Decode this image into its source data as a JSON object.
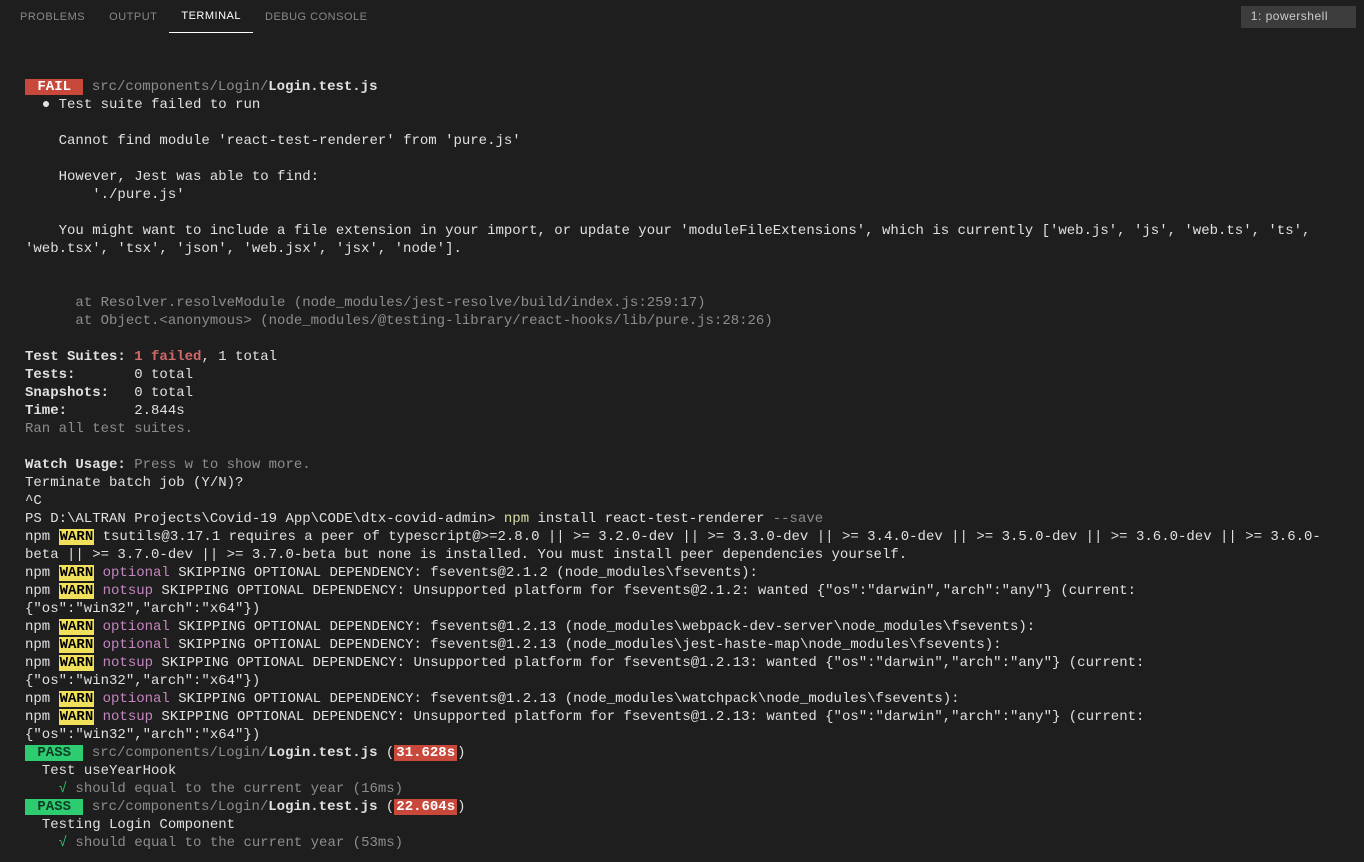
{
  "tabs": {
    "problems": "PROBLEMS",
    "output": "OUTPUT",
    "terminal": "TERMINAL",
    "debug": "DEBUG CONSOLE"
  },
  "shell": "1: powershell",
  "fail": {
    "badge": " FAIL ",
    "path_dim": " src/components/Login/",
    "path_file": "Login.test.js",
    "bullet": "  ● ",
    "suite_failed": "Test suite failed to run",
    "err_line": "    Cannot find module 'react-test-renderer' from 'pure.js'",
    "however": "    However, Jest was able to find:",
    "purejs": "        './pure.js'",
    "hint": "    You might want to include a file extension in your import, or update your 'moduleFileExtensions', which is currently ['web.js', 'js', 'web.ts', 'ts', 'web.tsx', 'tsx', 'json', 'web.jsx', 'jsx', 'node'].",
    "stack1": "      at Resolver.resolveModule (node_modules/jest-resolve/build/index.js:259:17)",
    "stack2": "      at Object.<anonymous> (node_modules/@testing-library/react-hooks/lib/pure.js:28:26)"
  },
  "summary": {
    "suites_label": "Test Suites: ",
    "suites_fail": "1 failed",
    "suites_rest": ", 1 total",
    "tests_label": "Tests:       ",
    "tests_val": "0 total",
    "snap_label": "Snapshots:   ",
    "snap_val": "0 total",
    "time_label": "Time:        ",
    "time_val": "2.844s",
    "ran": "Ran all test suites."
  },
  "watch": {
    "label": "Watch Usage: ",
    "text": "Press w to show more."
  },
  "batch": {
    "terminate": "Terminate batch job (Y/N)?",
    "ctrlc": "^C"
  },
  "prompt": {
    "path": "PS D:\\ALTRAN Projects\\Covid-19 App\\CODE\\dtx-covid-admin> ",
    "cmd_npm": "npm",
    "cmd_rest": " install react-test-renderer ",
    "cmd_save": "--save"
  },
  "npm_lines": [
    {
      "prefix": "npm ",
      "warn": "WARN",
      "mid": " tsutils@3.17.1 requires a peer of typescript@>=2.8.0 || >= 3.2.0-dev || >= 3.3.0-dev || >= 3.4.0-dev || >= 3.5.0-dev || >= 3.6.0-dev || >= 3.6.0-beta || >= 3.7.0-dev || >= 3.7.0-beta but none is installed. You must install peer dependencies yourself."
    },
    {
      "prefix": "npm ",
      "warn": "WARN",
      "kind": " optional",
      "mid": " SKIPPING OPTIONAL DEPENDENCY: fsevents@2.1.2 (node_modules\\fsevents):"
    },
    {
      "prefix": "npm ",
      "warn": "WARN",
      "kind": " notsup",
      "mid": " SKIPPING OPTIONAL DEPENDENCY: Unsupported platform for fsevents@2.1.2: wanted {\"os\":\"darwin\",\"arch\":\"any\"} (current: {\"os\":\"win32\",\"arch\":\"x64\"})"
    },
    {
      "prefix": "npm ",
      "warn": "WARN",
      "kind": " optional",
      "mid": " SKIPPING OPTIONAL DEPENDENCY: fsevents@1.2.13 (node_modules\\webpack-dev-server\\node_modules\\fsevents):"
    },
    {
      "prefix": "npm ",
      "warn": "WARN",
      "kind": " optional",
      "mid": " SKIPPING OPTIONAL DEPENDENCY: fsevents@1.2.13 (node_modules\\jest-haste-map\\node_modules\\fsevents):"
    },
    {
      "prefix": "npm ",
      "warn": "WARN",
      "kind": " notsup",
      "mid": " SKIPPING OPTIONAL DEPENDENCY: Unsupported platform for fsevents@1.2.13: wanted {\"os\":\"darwin\",\"arch\":\"any\"} (current: {\"os\":\"win32\",\"arch\":\"x64\"})"
    },
    {
      "prefix": "npm ",
      "warn": "WARN",
      "kind": " optional",
      "mid": " SKIPPING OPTIONAL DEPENDENCY: fsevents@1.2.13 (node_modules\\watchpack\\node_modules\\fsevents):"
    },
    {
      "prefix": "npm ",
      "warn": "WARN",
      "kind": " notsup",
      "mid": " SKIPPING OPTIONAL DEPENDENCY: Unsupported platform for fsevents@1.2.13: wanted {\"os\":\"darwin\",\"arch\":\"any\"} (current: {\"os\":\"win32\",\"arch\":\"x64\"})"
    }
  ],
  "pass1": {
    "badge": " PASS ",
    "path_dim": " src/components/Login/",
    "path_file": "Login.test.js",
    "open": " (",
    "time": "31.628s",
    "close": ")",
    "desc": "  Test useYearHook",
    "check": "    √ ",
    "test": "should equal to the current year (16ms)"
  },
  "pass2": {
    "badge": " PASS ",
    "path_dim": " src/components/Login/",
    "path_file": "Login.test.js",
    "open": " (",
    "time": "22.604s",
    "close": ")",
    "desc": "  Testing Login Component",
    "check": "    √ ",
    "test": "should equal to the current year (53ms)"
  }
}
